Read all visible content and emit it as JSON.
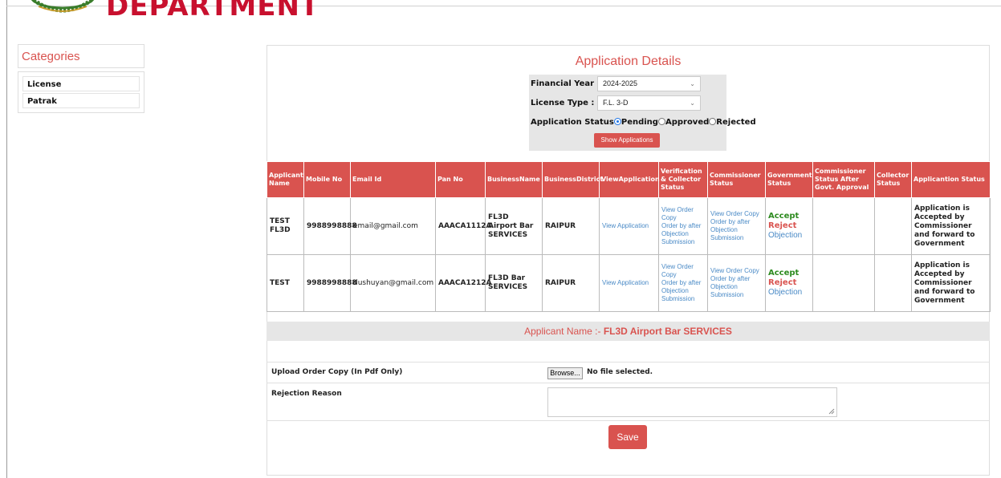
{
  "header": {
    "department": "DEPARTMENT"
  },
  "sidebar": {
    "title": "Categories",
    "items": [
      {
        "label": "License"
      },
      {
        "label": "Patrak"
      }
    ]
  },
  "main": {
    "title": "Application Details",
    "filters": {
      "financial_year_label": "Financial Year :",
      "financial_year_value": "2024-2025",
      "license_type_label": "License Type :",
      "license_type_value": "F.L. 3-D",
      "status_label": "Application Status",
      "status_options": [
        "Pending",
        "Approved",
        "Rejected"
      ],
      "status_selected": "Pending",
      "show_button": "Show Applications"
    },
    "table": {
      "columns": [
        "Applicant Name",
        "Mobile No",
        "Email Id",
        "Pan No",
        "BusinessName",
        "BusinessDistrict",
        "ViewApplication",
        "Verification & Collector Status",
        "Commissioner Status",
        "Government Status",
        "Commissioner Status After Govt. Approval",
        "Collector Status",
        "Applicantion Status"
      ],
      "rows": [
        {
          "name": "TEST FL3D",
          "mobile": "9988998888",
          "email": "email@gmail.com",
          "pan": "AAACA1112A",
          "business": "FL3D Airport Bar SERVICES",
          "district": "RAIPUR",
          "view": "View Application",
          "verification": [
            "View Order Copy",
            "Order by after Objection Submission"
          ],
          "commissioner": [
            "View Order Copy",
            "Order by after Objection Submission"
          ],
          "government": [
            "Accept",
            "Reject",
            "Objection"
          ],
          "commissioner_after": "",
          "collector": "",
          "status": "Application is Accepted by Commissioner and forward to Government"
        },
        {
          "name": "TEST",
          "mobile": "9988998888",
          "email": "dushuyan@gmail.com",
          "pan": "AAACA1212A",
          "business": "FL3D Bar SERVICES",
          "district": "RAIPUR",
          "view": "View Application",
          "verification": [
            "View Order Copy",
            "Order by after Objection Submission"
          ],
          "commissioner": [
            "View Order Copy",
            "Order by after Objection Submission"
          ],
          "government": [
            "Accept",
            "Reject",
            "Objection"
          ],
          "commissioner_after": "",
          "collector": "",
          "status": "Application is Accepted by Commissioner and forward to Government"
        }
      ]
    },
    "applicant_bar": {
      "prefix": "Applicant Name :-",
      "name": "FL3D Airport Bar SERVICES"
    },
    "form": {
      "upload_label": "Upload Order Copy (In Pdf Only)",
      "browse_label": "Browse...",
      "no_file": "No file selected.",
      "rejection_label": "Rejection Reason",
      "rejection_value": "",
      "save_label": "Save"
    }
  },
  "colors": {
    "accent": "#d9534f",
    "link": "#4a8ac6",
    "accept": "#2e8b20",
    "panel_gray": "#e6e6e6"
  }
}
